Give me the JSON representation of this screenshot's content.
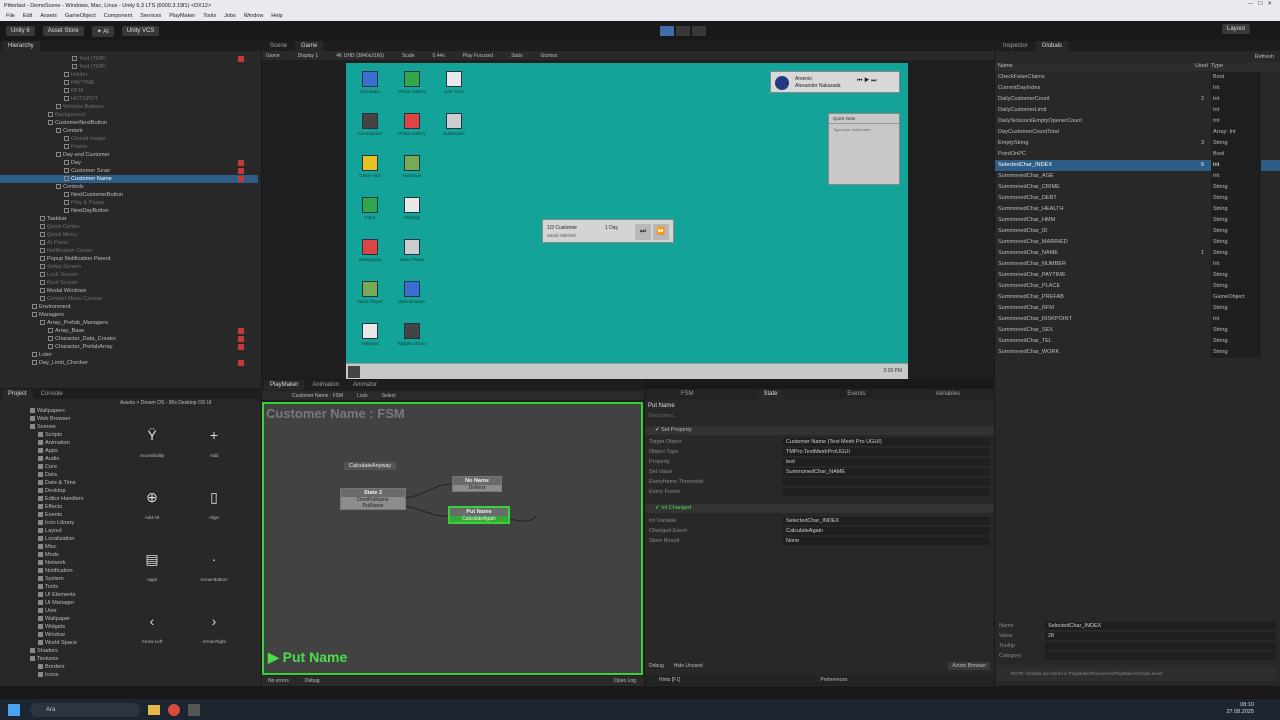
{
  "window": {
    "title": "Pitterlast - DemoScene - Windows, Mac, Linux - Unity 6.3 LTS (6000.3.19f1) <DX12>",
    "menu": [
      "File",
      "Edit",
      "Assets",
      "GameObject",
      "Component",
      "Services",
      "PlayMaker",
      "Tools",
      "Jobs",
      "Window",
      "Help"
    ]
  },
  "toolbar": {
    "unity_label": "Unity 6",
    "asset_store": "Asset Store",
    "vcs": "Unity VCS",
    "layout": "Layout"
  },
  "hierarchy": {
    "tab": "Hierarchy",
    "items": [
      {
        "label": "Text (TMP)",
        "indent": 4,
        "dim": true,
        "red": true
      },
      {
        "label": "Text (TMP)",
        "indent": 4,
        "dim": true
      },
      {
        "label": "Holder",
        "indent": 3,
        "dim": true
      },
      {
        "label": "PAYTIME",
        "indent": 3,
        "dim": true
      },
      {
        "label": "RFM",
        "indent": 3,
        "dim": true
      },
      {
        "label": "HOTSPOT",
        "indent": 3,
        "dim": true
      },
      {
        "label": "Window Buttons",
        "indent": 2,
        "dim": true
      },
      {
        "label": "Background",
        "indent": 1,
        "dim": true
      },
      {
        "label": "CustomerNextButton",
        "indent": 1
      },
      {
        "label": "Content",
        "indent": 2
      },
      {
        "label": "Closed Image",
        "indent": 3,
        "dim": true
      },
      {
        "label": "Frame",
        "indent": 3,
        "dim": true
      },
      {
        "label": "Day and Customer",
        "indent": 2
      },
      {
        "label": "Day",
        "indent": 3,
        "red": true
      },
      {
        "label": "Customer Sıras",
        "indent": 3,
        "red": true
      },
      {
        "label": "Customer Name",
        "indent": 3,
        "red": true,
        "sel": true
      },
      {
        "label": "Controls",
        "indent": 2
      },
      {
        "label": "NextCustomerButton",
        "indent": 3
      },
      {
        "label": "Play & Pause",
        "indent": 3,
        "dim": true
      },
      {
        "label": "NextDayButton",
        "indent": 3
      },
      {
        "label": "Taskbar",
        "indent": 0
      },
      {
        "label": "Quick Center",
        "indent": 0,
        "dim": true
      },
      {
        "label": "Quick Menu",
        "indent": 0,
        "dim": true
      },
      {
        "label": "AI Panel",
        "indent": 0,
        "dim": true
      },
      {
        "label": "Notification Center",
        "indent": 0,
        "dim": true
      },
      {
        "label": "Popup Notification Parent",
        "indent": 0
      },
      {
        "label": "Setup Screen",
        "indent": 0,
        "dim": true
      },
      {
        "label": "Lock Screen",
        "indent": 0,
        "dim": true
      },
      {
        "label": "Boot Screen",
        "indent": 0,
        "dim": true
      },
      {
        "label": "Modal Windows",
        "indent": 0
      },
      {
        "label": "Context Menu Canvas",
        "indent": 0,
        "dim": true
      },
      {
        "label": "Environment",
        "indent": -1
      },
      {
        "label": "Managers",
        "indent": -1
      },
      {
        "label": "Array_Prefab_Managers",
        "indent": 0
      },
      {
        "label": "Array_Base",
        "indent": 1,
        "red": true
      },
      {
        "label": "Character_Data_Creator",
        "indent": 1,
        "red": true
      },
      {
        "label": "Character_PrefabArray",
        "indent": 1,
        "red": true
      },
      {
        "label": "Loter",
        "indent": -1
      },
      {
        "label": "Day_Limit_Checker",
        "indent": -1,
        "red": true
      }
    ]
  },
  "scene": {
    "tabs": [
      "Scene",
      "Game"
    ],
    "game_bar": [
      "Game",
      "Display 1",
      "4K UHD (3840x2160)",
      "Scale",
      "0.44x",
      "Play Focused",
      "Stats",
      "Gizmos"
    ],
    "desktop_icons": [
      [
        "Calculator",
        "Photo Gallery",
        "Icon Form"
      ],
      [
        "Commander",
        "Photo Gallery",
        "SubStocks"
      ],
      [
        "Game Hub",
        "Notebook"
      ],
      [
        "Paint",
        "Settings"
      ],
      [
        "Messaging",
        "Video Player"
      ],
      [
        "Music Player",
        "Web Browser"
      ],
      [
        "Notepad",
        "Widget Library"
      ]
    ],
    "music": {
      "title": "Arsenio",
      "artist": "Alexander Nakarada"
    },
    "sticky": {
      "title": "Quick Note",
      "placeholder": "Type your notes here"
    },
    "widget": {
      "customer": "1/3 Customer",
      "day": "1 Day",
      "name": "Sarah Mitchell"
    },
    "clock": "3:26 PM"
  },
  "inspector": {
    "tabs": [
      "Inspector",
      "Globals"
    ],
    "refresh": "Refresh",
    "headers": [
      "Name",
      "Used",
      "Type"
    ],
    "rows": [
      {
        "name": "CheckFalseClaims",
        "used": "",
        "type": "Bool"
      },
      {
        "name": "CurrentDayIndex",
        "used": "",
        "type": "Int"
      },
      {
        "name": "DailyCustomerCount",
        "used": "2",
        "type": "Int"
      },
      {
        "name": "DailyCustomerLimit",
        "used": "",
        "type": "Int"
      },
      {
        "name": "DailySicksockEmptyOpenerCount",
        "used": "",
        "type": "Int"
      },
      {
        "name": "DayCustomerCountTotal",
        "used": "",
        "type": "Array: Int"
      },
      {
        "name": "EmptyString",
        "used": "3",
        "type": "String"
      },
      {
        "name": "PointOnPC",
        "used": "",
        "type": "Bool"
      },
      {
        "name": "SelectedChar_INDEX",
        "used": "5",
        "type": "Int",
        "sel": true
      },
      {
        "name": "SummonedChar_AGE",
        "used": "",
        "type": "Int"
      },
      {
        "name": "SummonedChar_CRIME",
        "used": "",
        "type": "String"
      },
      {
        "name": "SummonedChar_DEBT",
        "used": "",
        "type": "String"
      },
      {
        "name": "SummonedChar_HEALTH",
        "used": "",
        "type": "String"
      },
      {
        "name": "SummonedChar_HMM",
        "used": "",
        "type": "String"
      },
      {
        "name": "SummonedChar_ID",
        "used": "",
        "type": "String"
      },
      {
        "name": "SummonedChar_MARRIED",
        "used": "",
        "type": "String"
      },
      {
        "name": "SummonedChar_NAME",
        "used": "1",
        "type": "String"
      },
      {
        "name": "SummonedChar_NUMBER",
        "used": "",
        "type": "Int"
      },
      {
        "name": "SummonedChar_PAYTIME",
        "used": "",
        "type": "String"
      },
      {
        "name": "SummonedChar_PLACE",
        "used": "",
        "type": "String"
      },
      {
        "name": "SummonedChar_PREFAB",
        "used": "",
        "type": "GameObject"
      },
      {
        "name": "SummonedChar_RFM",
        "used": "",
        "type": "String"
      },
      {
        "name": "SummonedChar_RISKPOINT",
        "used": "",
        "type": "Int"
      },
      {
        "name": "SummonedChar_SEX",
        "used": "",
        "type": "String"
      },
      {
        "name": "SummonedChar_TEL",
        "used": "",
        "type": "String"
      },
      {
        "name": "SummonedChar_WORK",
        "used": "",
        "type": "String"
      }
    ],
    "detail": [
      {
        "k": "Name",
        "v": "SelectedChar_INDEX"
      },
      {
        "k": "Value",
        "v": "28"
      },
      {
        "k": "Tooltip",
        "v": ""
      },
      {
        "k": "Category",
        "v": ""
      }
    ],
    "note": "NOTE: Globals are stored in PlayMaker/Resources/PlayMakerGlobals.asset"
  },
  "project": {
    "tabs": [
      "Project",
      "Console"
    ],
    "breadcrumb": "Assets > Dream OS - 90s Desktop OS UI",
    "folders": [
      "Wallpapers",
      "Web Browser",
      "Scenes",
      "Scripts",
      "Animation",
      "Apps",
      "Audio",
      "Core",
      "Data",
      "Date & Time",
      "Desktop",
      "Editor Handlers",
      "Effects",
      "Events",
      "Icon Library",
      "Layout",
      "Localization",
      "Misc",
      "Mods",
      "Network",
      "Notification",
      "System",
      "Tools",
      "UI Elements",
      "UI Manager",
      "User",
      "Wallpaper",
      "Widgets",
      "Window",
      "World Space",
      "Shaders",
      "Textures",
      "Borders",
      "Icons"
    ],
    "assets": [
      [
        "Accessibility",
        "Add"
      ],
      [
        "Add Alt",
        "Align"
      ],
      [
        "Apps",
        "Arrow Bottom"
      ],
      [
        "Arrow Left",
        "Arrow Right"
      ]
    ]
  },
  "fsm": {
    "tabs": [
      "PlayMaker",
      "Animation",
      "Animator"
    ],
    "toolbar": [
      "Customer Name : FSM",
      "Lock",
      "Select"
    ],
    "title": "Customer Name : FSM",
    "state_name": "Put Name",
    "global_event": "CalculateAnyway",
    "state2": {
      "title": "State 2",
      "events": [
        "DontPutName",
        "PutName"
      ]
    },
    "noname": {
      "title": "No Name",
      "events": [
        "DoNext"
      ]
    },
    "putname": {
      "title": "Put Name",
      "events": [
        "CalculateAgain"
      ]
    },
    "status": [
      "No errors",
      "Debug",
      "Open Log"
    ]
  },
  "state_inspector": {
    "tabs": [
      "FSM",
      "State",
      "Events",
      "Variables"
    ],
    "state_name": "Put Name",
    "description": "Description...",
    "action1": {
      "title": "Set Property",
      "fields": [
        {
          "k": "Target Object",
          "v": "Customer Name (Text Mesh Pro UGUI)"
        },
        {
          "k": "Object Type",
          "v": "TMPro.TextMeshProUGUI"
        },
        {
          "k": "Property",
          "v": "text"
        },
        {
          "k": "Set Value",
          "v": "SummonedChar_NAME"
        },
        {
          "k": "Everyframe Threshold",
          "v": ""
        },
        {
          "k": "Every Frame",
          "v": ""
        }
      ]
    },
    "action2": {
      "title": "Int Changed",
      "fields": [
        {
          "k": "Int Variable",
          "v": "SelectedChar_INDEX"
        },
        {
          "k": "Changed Event",
          "v": "CalculateAgain"
        },
        {
          "k": "Store Result",
          "v": "None"
        }
      ]
    },
    "bottom": [
      "Debug",
      "Hide Unused",
      "Action Browser"
    ],
    "footer": [
      "Hints [F1]",
      "Preferences"
    ]
  },
  "taskbar": {
    "search": "Ara",
    "time": "08:10",
    "date": "27.08.2025"
  }
}
